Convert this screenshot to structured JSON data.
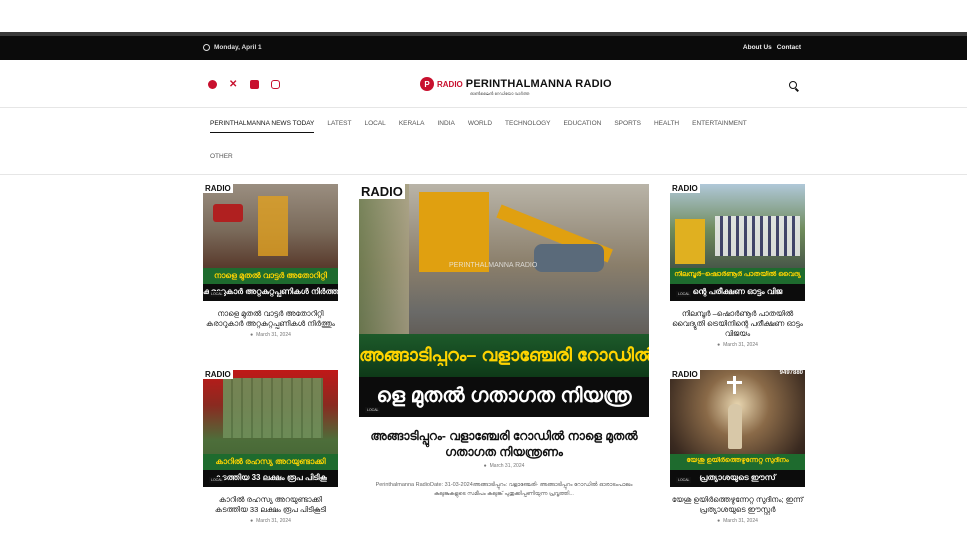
{
  "topbar": {
    "date": "Monday, April 1",
    "about": "About Us",
    "contact": "Contact"
  },
  "brand": {
    "radio": "RADIO",
    "name": "PERINTHALMANNA RADIO",
    "tagline": "ഓൺലൈൻ റേഡിയോ വാർത്ത"
  },
  "social": [
    "facebook-icon",
    "x-icon",
    "youtube-icon",
    "instagram-icon"
  ],
  "nav": {
    "items": [
      "PERINTHALMANNA NEWS TODAY",
      "LATEST",
      "LOCAL",
      "KERALA",
      "INDIA",
      "WORLD",
      "TECHNOLOGY",
      "EDUCATION",
      "SPORTS",
      "HEALTH",
      "ENTERTAINMENT",
      "OTHER"
    ]
  },
  "cards": {
    "c1": {
      "title": "നാളെ മുതൽ വാട്ടർ അതോറിറ്റി കരാറുകാർ അറ്റകുറ്റപ്പണികൾ നിർത്തും",
      "date": "March 31, 2024",
      "cap1": "നാളെ മുതൽ വാട്ടർ അതോറിറ്റി",
      "cap2": "കരാറുകാർ അറ്റകുറ്റപ്പണികൾ നിർത്ത",
      "badge": "LOCAL",
      "logo": "RADIO"
    },
    "c2": {
      "title": "കാറിൽ രഹസ്യ അറയുണ്ടാക്കി കടത്തിയ 33 ലക്ഷം രൂപ പിടികൂടി",
      "date": "March 31, 2024",
      "cap1": "കാറിൽ രഹസ്യ അറയുണ്ടാക്കി",
      "cap2": "കടത്തിയ 33 ലക്ഷം രൂപ പിടികൂ",
      "badge": "LOCAL",
      "logo": "RADIO"
    },
    "main": {
      "title": "അങ്ങാടിപ്പുറം- വളാഞ്ചേരി റോഡിൽ നാളെ മുതൽ ഗതാഗത നിയന്ത്രണം",
      "date": "March 31, 2024",
      "excerpt": "Perinthalmanna RadioDate: 31-03-2024അങ്ങാടിപ്പുറം: വളാഞ്ചേരി- അങ്ങാടിപ്പുറം റോഡിൽ ഓരാടംപാലം കലുങ്കുകളുടെ സമീപം കലുങ്ക് പുതുക്കിപ്പണിയുന്ന പ്രവൃത്തി...",
      "cap1": "അങ്ങാടിപ്പുറം– വളാഞ്ചേരി റോഡിൽ",
      "cap2": "ളെ മുതൽ ഗതാഗത നിയന്ത്ര",
      "watermark": "PERINTHALMANNA RADIO",
      "badge": "LOCAL",
      "logo": "RADIO"
    },
    "c3": {
      "title": "നിലമ്പൂർ –ഷൊർണൂർ പാതയിൽ വൈദ്യുതി ട്രെയിനിന്റെ പരീക്ഷണ ഓട്ടം വിജയം",
      "date": "March 31, 2024",
      "cap1": "നിലമ്പൂർ–ഷൊർണൂർ പാതയിൽ വൈദ്യ",
      "cap2": "ന്റെ പരീക്ഷണ ഓട്ടം വിജ",
      "badge": "LOCAL",
      "logo": "RADIO"
    },
    "c4": {
      "title": "യേശു ഉയിർത്തെഴുന്നേറ്റ സുദിനം; ഇന്ന് പ്രത്യാശയുടെ ഈസ്റ്റർ",
      "date": "March 31, 2024",
      "cap1": "യേശു ഉയിർത്തെഴുന്നേറ്റ സുദിനം",
      "cap2": "പ്രത്യാശയുടെ ഈസ്",
      "badge": "LOCAL",
      "logo": "RADIO",
      "phone": "9497880"
    }
  },
  "colors": {
    "brand_red": "#c8102e",
    "caption_green": "#1e6b2e",
    "caption_yellow": "#ffd400"
  }
}
